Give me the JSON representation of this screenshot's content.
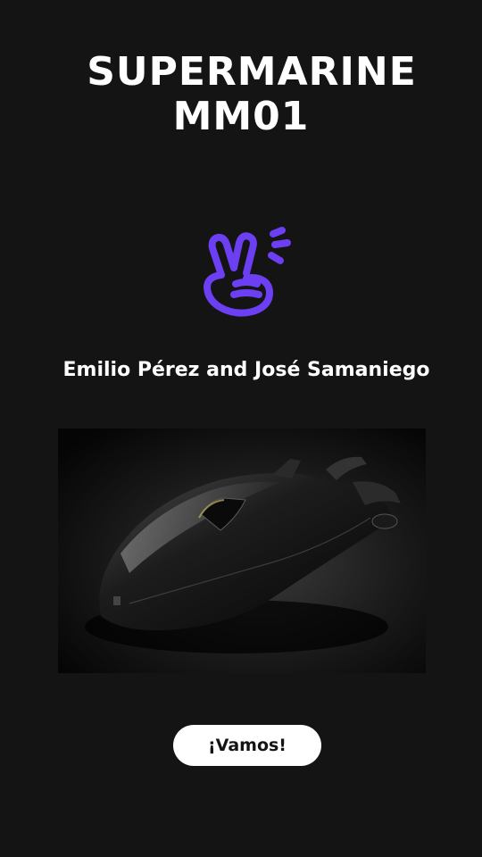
{
  "title": {
    "line1": "SUPERMARINE",
    "line2": "MM01"
  },
  "hand_icon": {
    "name": "peace-hand-icon",
    "color": "#6c3ff2"
  },
  "authors": "Emilio Pérez and José Samaniego",
  "photo": {
    "subject": "black concept watercraft on dark background"
  },
  "cta": {
    "label": "¡Vamos!",
    "background": "#ffffff",
    "text_color": "#141414"
  },
  "colors": {
    "background": "#141414",
    "text": "#ffffff"
  }
}
